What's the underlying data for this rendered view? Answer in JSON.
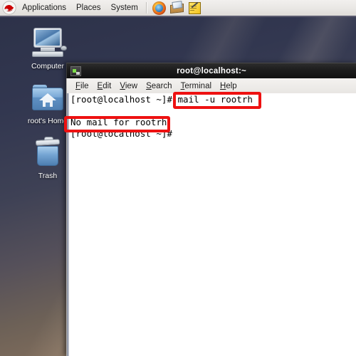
{
  "panel": {
    "logo_name": "red-hat-logo",
    "menus": [
      {
        "label": "Applications"
      },
      {
        "label": "Places"
      },
      {
        "label": "System"
      }
    ],
    "launchers": [
      {
        "name": "firefox-icon",
        "title": "Firefox Web Browser"
      },
      {
        "name": "evolution-mail-icon",
        "title": "Evolution Mail"
      },
      {
        "name": "text-editor-icon",
        "title": "Text Editor"
      }
    ],
    "background_color": "#e9e7e4"
  },
  "desktop": {
    "background_top_color": "#2d3249",
    "background_bottom_color": "#917a63",
    "icons": [
      {
        "name": "computer",
        "label": "Computer"
      },
      {
        "name": "home-folder",
        "label": "root's Home"
      },
      {
        "name": "trash",
        "label": "Trash"
      }
    ]
  },
  "terminal": {
    "title": "root@localhost:~",
    "icon_name": "terminal-icon",
    "menus": [
      {
        "label": "File",
        "mnemonic": "F"
      },
      {
        "label": "Edit",
        "mnemonic": "E"
      },
      {
        "label": "View",
        "mnemonic": "V"
      },
      {
        "label": "Search",
        "mnemonic": "S"
      },
      {
        "label": "Terminal",
        "mnemonic": "T"
      },
      {
        "label": "Help",
        "mnemonic": "H"
      }
    ],
    "lines": [
      "[root@localhost ~]# mail -u rootrh",
      "",
      "No mail for rootrh",
      "[root@localhost ~]#"
    ],
    "content": "[root@localhost ~]# mail -u rootrh\n\nNo mail for rootrh\n[root@localhost ~]#",
    "prompt": "[root@localhost ~]#",
    "command": "mail -u rootrh",
    "output": "No mail for rootrh",
    "background_color": "#ffffff",
    "text_color": "#000000",
    "titlebar_color": "#1b1b1b"
  },
  "annotations": {
    "color": "#ee1111",
    "boxes": [
      {
        "name": "command-highlight",
        "target": "mail -u rootrh"
      },
      {
        "name": "output-highlight",
        "target": "No mail for rootrh"
      }
    ]
  }
}
